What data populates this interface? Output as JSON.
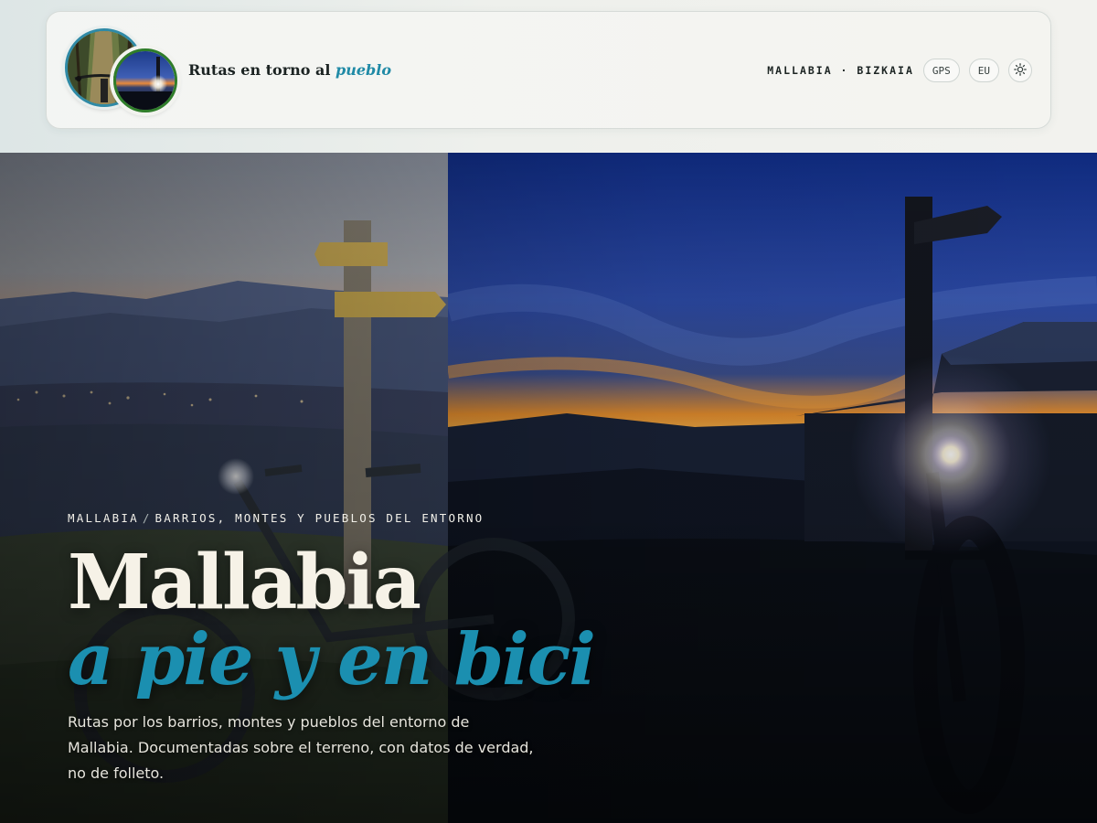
{
  "header": {
    "brand_main": "Rutas en torno al",
    "brand_accent": "pueblo",
    "logo_images": [
      "forest-trail-bike-thumbnail",
      "night-headlight-bike-thumbnail"
    ],
    "locale": "MALLABIA · BIZKAIA",
    "buttons": {
      "gps": "GPS",
      "language": "EU",
      "theme_icon": "sun-icon"
    }
  },
  "hero": {
    "breadcrumb": [
      "MALLABIA",
      "BARRIOS, MONTES Y PUEBLOS DEL ENTORNO"
    ],
    "breadcrumb_separator": "/",
    "title_line1": "Mallabia",
    "title_line2": "a pie y en bici",
    "description": "Rutas por los barrios, montes y pueblos del entorno de Mallabia. Documentadas sobre el terreno, con datos de verdad, no de folleto."
  },
  "colors": {
    "accent": "#1b8fb0",
    "logo_ring_blue": "#2f8aa6",
    "logo_ring_green": "#2f7d2a",
    "title_light": "#f6f2e7"
  }
}
